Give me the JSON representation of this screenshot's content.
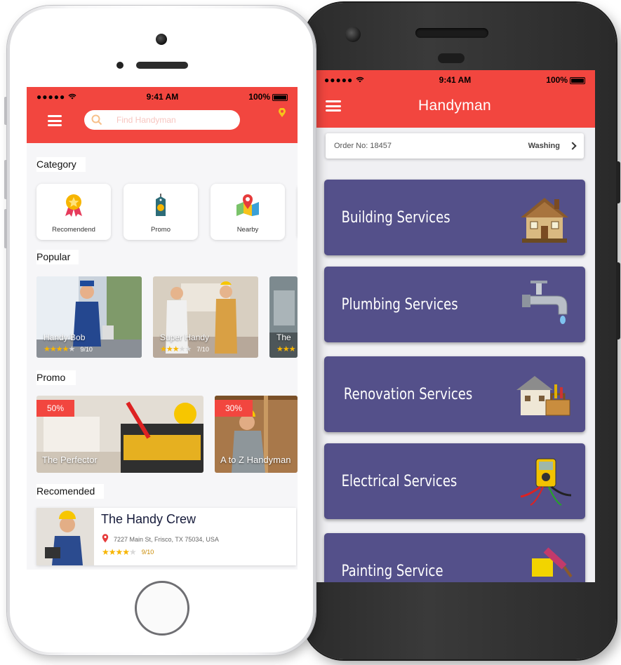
{
  "status_bar": {
    "signal": "●●●●●",
    "wifi_icon": "wifi-icon",
    "time": "9:41 AM",
    "battery": "100%"
  },
  "colors": {
    "accent": "#f2463f",
    "service_tile": "#54508a",
    "star": "#f7b500"
  },
  "left_phone": {
    "search": {
      "placeholder": "Find Handyman"
    },
    "sections": {
      "category": "Category",
      "popular": "Popular",
      "promo": "Promo",
      "recommended": "Recomended"
    },
    "categories": [
      {
        "label": "Recomendend",
        "icon": "medal-icon"
      },
      {
        "label": "Promo",
        "icon": "price-tag-icon"
      },
      {
        "label": "Nearby",
        "icon": "map-pin-icon"
      }
    ],
    "popular": [
      {
        "name": "Handy Bob",
        "rating": 4,
        "score": "9/10"
      },
      {
        "name": "Super Handy",
        "rating": 3,
        "score": "7/10"
      },
      {
        "name": "The",
        "rating": 3,
        "score": ""
      }
    ],
    "promos": [
      {
        "discount": "50%",
        "name": "The Perfector"
      },
      {
        "discount": "30%",
        "name": "A to Z Handyman"
      }
    ],
    "recommended": {
      "name": "The Handy Crew",
      "address": "7227 Main St, Frisco, TX 75034, USA",
      "rating": 4,
      "score": "9/10"
    }
  },
  "right_phone": {
    "title": "Handyman",
    "order": {
      "number": "Order No: 18457",
      "status": "Washing"
    },
    "services": [
      {
        "label": "Building Services",
        "icon": "house-icon"
      },
      {
        "label": "Plumbing Services",
        "icon": "faucet-icon"
      },
      {
        "label": "Renovation Services",
        "icon": "toolbox-house-icon"
      },
      {
        "label": "Electrical Services",
        "icon": "multimeter-icon"
      },
      {
        "label": "Painting Service",
        "icon": "paint-roller-icon"
      }
    ]
  }
}
